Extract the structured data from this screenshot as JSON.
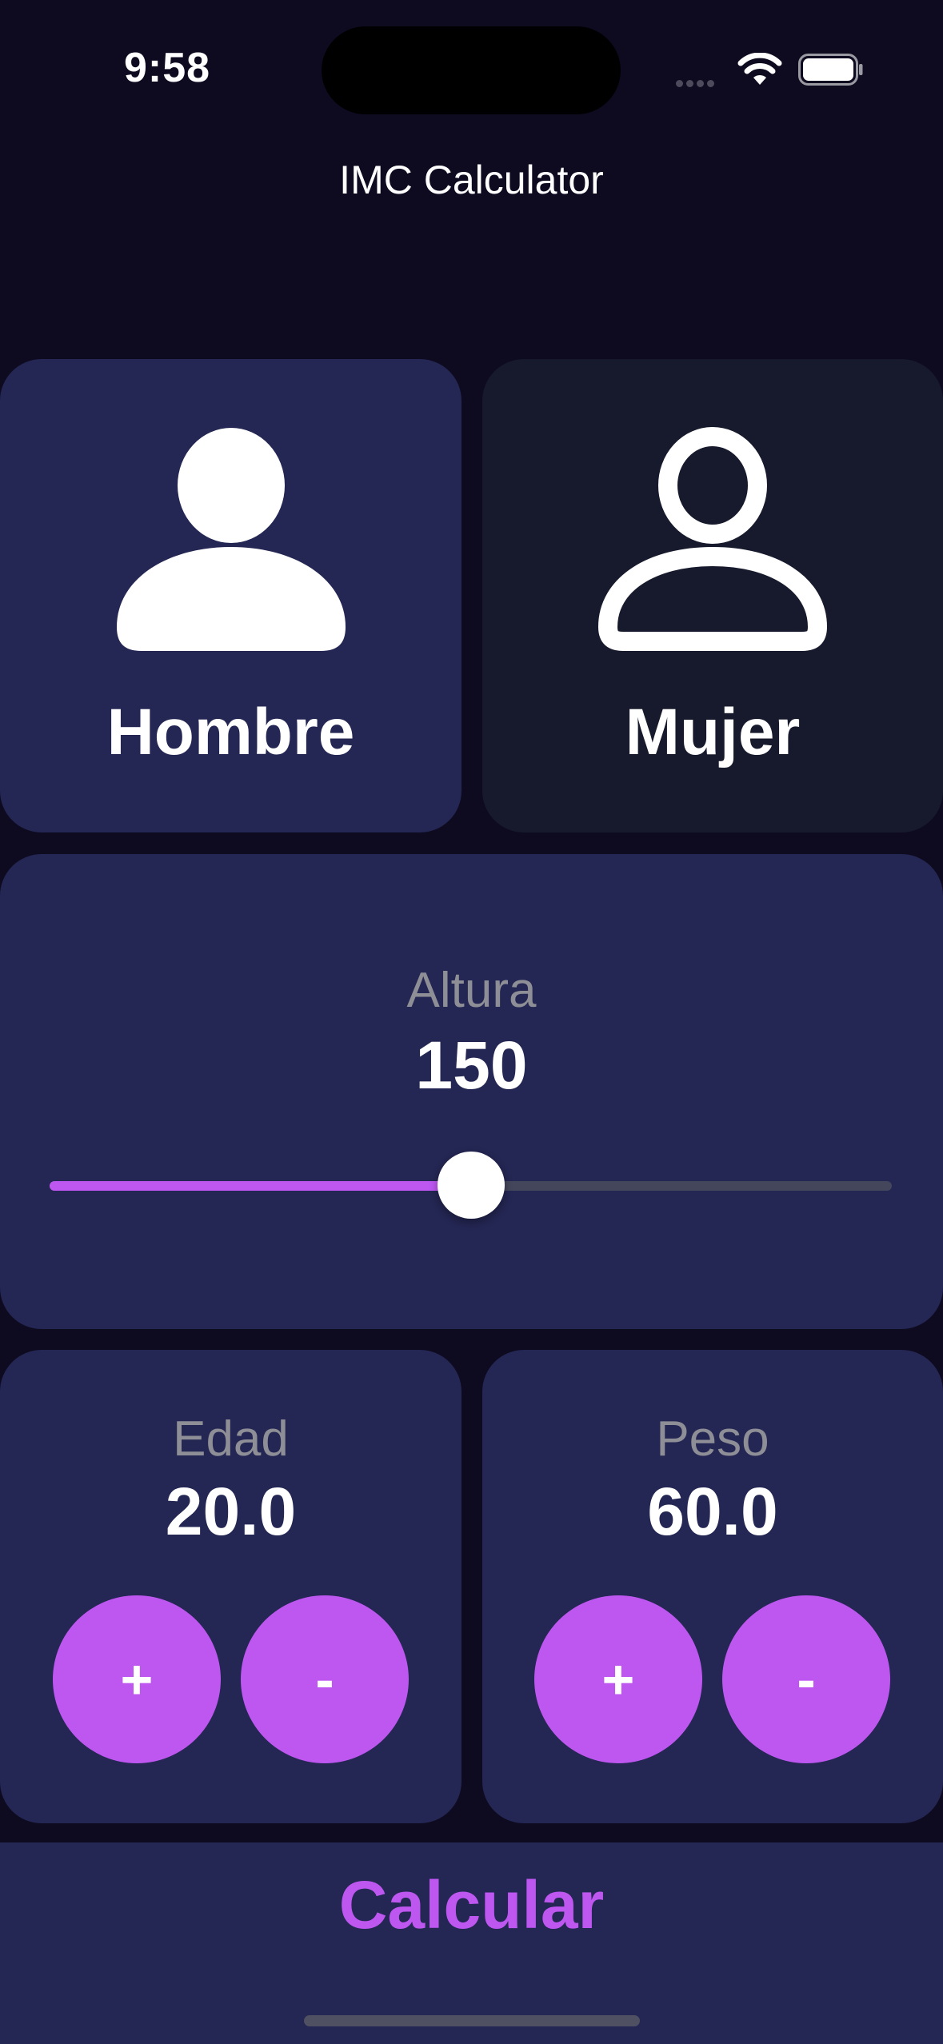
{
  "status_bar": {
    "time": "9:58"
  },
  "app": {
    "title": "IMC Calculator"
  },
  "gender": {
    "male": {
      "label": "Hombre",
      "icon": "person-filled-icon",
      "selected": true
    },
    "female": {
      "label": "Mujer",
      "icon": "person-outline-icon",
      "selected": false
    }
  },
  "height": {
    "label": "Altura",
    "value": "150",
    "slider_fraction": 0.5
  },
  "age": {
    "label": "Edad",
    "value": "20.0",
    "plus": "+",
    "minus": "-"
  },
  "weight": {
    "label": "Peso",
    "value": "60.0",
    "plus": "+",
    "minus": "-"
  },
  "calculate": {
    "label": "Calcular"
  },
  "colors": {
    "background": "#0e0b21",
    "card": "#242653",
    "card_unselected": "#171a2d",
    "accent": "#bd57f0",
    "muted_text": "#8e8e96"
  }
}
